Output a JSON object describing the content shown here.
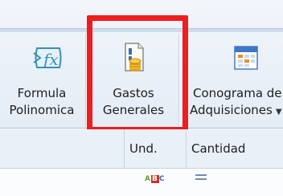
{
  "ribbon": {
    "buttons": [
      {
        "line1": "Formula",
        "line2": "Polinomica"
      },
      {
        "line1": "Gastos",
        "line2": "Generales"
      },
      {
        "line1": "Conograma de",
        "line2": "Adquisiciones"
      }
    ],
    "icons": [
      "formula-fx-icon",
      "coins-document-icon",
      "calendar-schedule-icon"
    ],
    "highlight_color": "#ef1d1d"
  },
  "grid": {
    "columns": [
      "",
      "Und.",
      "Cantidad"
    ],
    "row_icons": [
      "abc-text-icon",
      "equals-icon"
    ]
  }
}
